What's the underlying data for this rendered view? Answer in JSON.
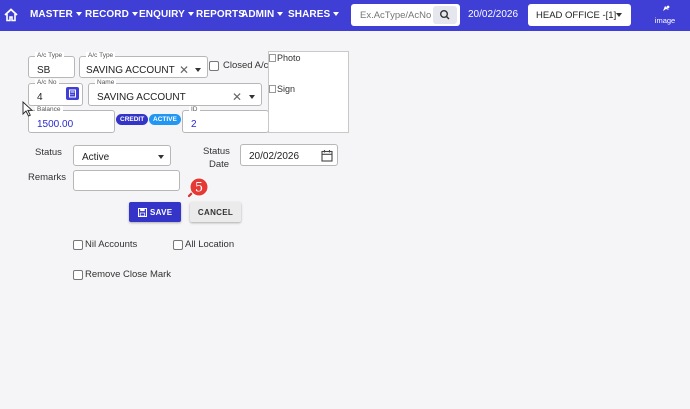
{
  "nav": {
    "items": [
      {
        "label": "MASTER",
        "caret": true
      },
      {
        "label": "RECORD",
        "caret": true
      },
      {
        "label": "ENQUIRY",
        "caret": true
      },
      {
        "label": "REPORTS",
        "caret": false
      },
      {
        "label": "ADMIN",
        "caret": true
      },
      {
        "label": "SHARES",
        "caret": true
      }
    ],
    "search_placeholder": "Ex.AcType/AcNo",
    "date": "20/02/2026",
    "branch": "HEAD OFFICE -[1]",
    "image_label": "image",
    "bg_color": "#3f3fd6"
  },
  "form": {
    "actype_code": {
      "label": "A/c Type",
      "value": "SB"
    },
    "actype_name": {
      "label": "A/c Type",
      "value": "SAVING ACCOUNT"
    },
    "closed_ac_label": "Closed A/c",
    "acno": {
      "label": "A/c No",
      "value": "4"
    },
    "name": {
      "label": "Name",
      "value": "SAVING ACCOUNT"
    },
    "balance": {
      "label": "Balance",
      "value": "1500.00"
    },
    "chips": {
      "credit": "CREDIT",
      "active": "ACTIVE"
    },
    "id": {
      "label": "ID",
      "value": "2"
    },
    "photo_alt": "Photo",
    "sign_alt": "Sign",
    "status_label": "Status",
    "status_value": "Active",
    "status_date_label_1": "Status",
    "status_date_label_2": "Date",
    "status_date_value": "20/02/2026",
    "remarks_label": "Remarks",
    "remarks_value": ""
  },
  "actions": {
    "save_label": "SAVE",
    "cancel_label": "CANCEL",
    "step_number": "5"
  },
  "options": {
    "nil_accounts": "Nil Accounts",
    "all_location": "All Location",
    "remove_close_mark": "Remove Close Mark"
  },
  "colors": {
    "accent": "#3f3fd6",
    "credit_chip": "#3434c8",
    "active_chip": "#2196f3",
    "step_badge": "#e53935"
  }
}
